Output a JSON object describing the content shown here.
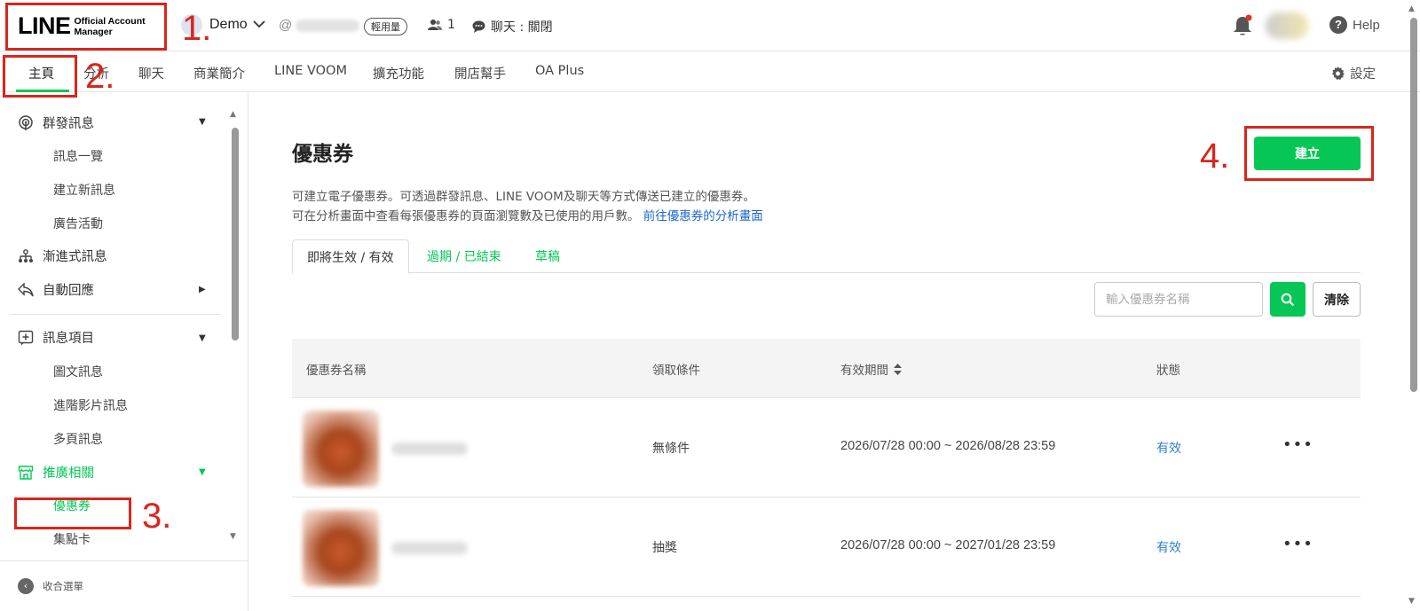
{
  "header": {
    "logo_main": "LINE",
    "logo_sub_line1": "Official Account",
    "logo_sub_line2": "Manager",
    "account_name": "Demo",
    "account_id_prefix": "@",
    "plan_badge": "輕用量",
    "friends_count": "1",
    "chat_status": "聊天 : 關閉",
    "help_label": "Help",
    "help_symbol": "?"
  },
  "annotations": [
    "1.",
    "2.",
    "3.",
    "4."
  ],
  "nav": {
    "items": [
      "主頁",
      "分析",
      "聊天",
      "商業簡介",
      "LINE VOOM",
      "擴充功能",
      "開店幫手",
      "OA Plus"
    ],
    "settings_label": "設定"
  },
  "sidebar": {
    "groups": [
      {
        "label": "群發訊息",
        "icon": "broadcast-icon",
        "sub": [
          "訊息一覽",
          "建立新訊息",
          "廣告活動"
        ]
      },
      {
        "label": "漸進式訊息",
        "icon": "hierarchy-icon"
      },
      {
        "label": "自動回應",
        "icon": "reply-icon"
      },
      {
        "label": "訊息項目",
        "icon": "add-box-icon",
        "sub": [
          "圖文訊息",
          "進階影片訊息",
          "多頁訊息"
        ]
      },
      {
        "label": "推廣相關",
        "icon": "store-icon",
        "sub": [
          "優惠券",
          "集點卡"
        ]
      }
    ],
    "collapse_label": "收合選單"
  },
  "main": {
    "title": "優惠券",
    "desc_line1": "可建立電子優惠券。可透過群發訊息、LINE VOOM及聊天等方式傳送已建立的優惠券。",
    "desc_line2": "可在分析畫面中查看每張優惠券的頁面瀏覽數及已使用的用戶數。",
    "desc_link": "前往優惠券的分析畫面",
    "create_label": "建立",
    "tabs": [
      "即將生效 / 有效",
      "過期 / 已結束",
      "草稿"
    ],
    "search_placeholder": "輸入優惠券名稱",
    "clear_label": "清除",
    "table": {
      "headers": [
        "優惠券名稱",
        "領取條件",
        "有效期間",
        "狀態"
      ],
      "rows": [
        {
          "condition": "無條件",
          "period": "2026/07/28 00:00 ~ 2026/08/28 23:59",
          "status": "有效",
          "more": "•••"
        },
        {
          "condition": "抽獎",
          "period": "2026/07/28 00:00 ~ 2027/01/28 23:59",
          "status": "有效",
          "more": "•••"
        }
      ]
    }
  },
  "colors": {
    "accent": "#06c755",
    "annotation": "#d9261c",
    "link": "#1a66d0",
    "status": "#2d7fd6"
  }
}
